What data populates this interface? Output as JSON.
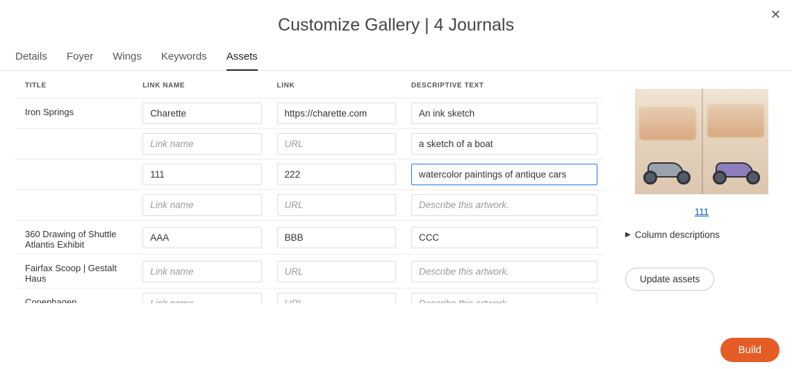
{
  "header": {
    "title": "Customize Gallery | 4 Journals"
  },
  "tabs": [
    "Details",
    "Foyer",
    "Wings",
    "Keywords",
    "Assets"
  ],
  "active_tab": "Assets",
  "columns": {
    "title": "Title",
    "link_name": "Link Name",
    "link": "Link",
    "descriptive_text": "Descriptive Text"
  },
  "placeholders": {
    "link_name": "Link name",
    "url": "URL",
    "describe": "Describe this artwork."
  },
  "rows": [
    {
      "title": "Iron Springs",
      "link_name": "Charette",
      "link": "https://charette.com",
      "desc": "An ink sketch"
    },
    {
      "title": "",
      "link_name": "",
      "link": "",
      "desc": "a sketch of a boat"
    },
    {
      "title": "",
      "link_name": "111",
      "link": "222",
      "desc": "watercolor paintings of antique cars",
      "focused": true
    },
    {
      "title": "",
      "link_name": "",
      "link": "",
      "desc": ""
    },
    {
      "title": "360 Drawing of Shuttle Atlantis Exhibit",
      "link_name": "AAA",
      "link": "BBB",
      "desc": "CCC"
    },
    {
      "title": "Fairfax Scoop | Gestalt Haus",
      "link_name": "",
      "link": "",
      "desc": ""
    },
    {
      "title": "Copenhagen",
      "link_name": "",
      "link": "",
      "desc": ""
    }
  ],
  "sidebar": {
    "caption_link_text": "111",
    "disclosure_label": "Column descriptions",
    "update_label": "Update assets"
  },
  "footer": {
    "build_label": "Build"
  }
}
